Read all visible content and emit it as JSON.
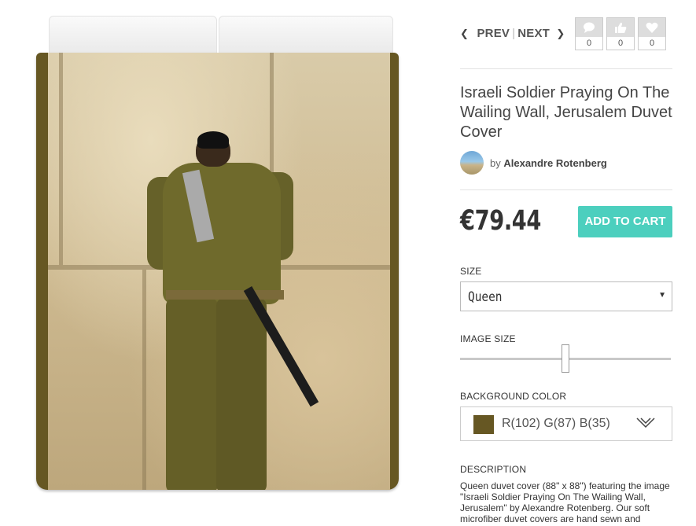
{
  "nav": {
    "prev_label": "PREV",
    "next_label": "NEXT",
    "separator": "|"
  },
  "social": [
    {
      "icon": "comment-icon",
      "count": "0"
    },
    {
      "icon": "thumbs-up-icon",
      "count": "0"
    },
    {
      "icon": "heart-icon",
      "count": "0"
    }
  ],
  "product": {
    "title": "Israeli Soldier Praying On The Wailing Wall, Jerusalem Duvet Cover",
    "artist_by": "by",
    "artist_name": "Alexandre Rotenberg",
    "price": "€79.44",
    "add_to_cart_label": "ADD TO CART"
  },
  "options": {
    "size_label": "SIZE",
    "size_value": "Queen",
    "image_size_label": "IMAGE SIZE",
    "image_size_fraction": 0.5,
    "background_label": "BACKGROUND COLOR",
    "background_value": "R(102) G(87) B(35)",
    "background_hex": "#665723"
  },
  "description": {
    "label": "DESCRIPTION",
    "text": "Queen duvet cover (88\" x 88\") featuring the image \"Israeli Soldier Praying On The Wailing Wall, Jerusalem\" by Alexandre Rotenberg. Our soft microfiber duvet covers are hand sewn and"
  },
  "colors": {
    "accent": "#4ccfbe",
    "border": "#665723"
  }
}
